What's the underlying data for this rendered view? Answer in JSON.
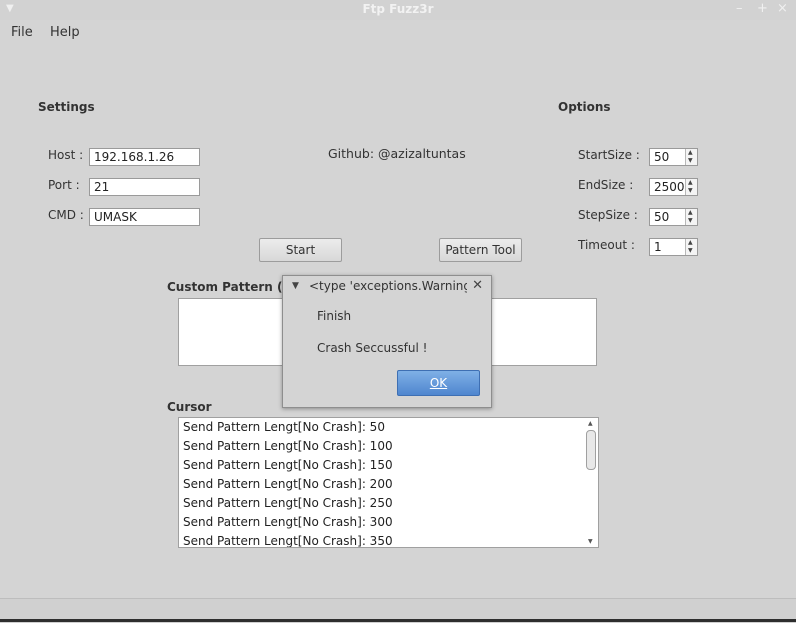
{
  "window": {
    "title": "Ftp Fuzz3r"
  },
  "menubar": {
    "file": "File",
    "help": "Help"
  },
  "settings": {
    "heading": "Settings",
    "host_label": "Host :",
    "host_value": "192.168.1.26",
    "port_label": "Port  :",
    "port_value": "21",
    "cmd_label": "CMD :",
    "cmd_value": "UMASK"
  },
  "github": "Github: @azizaltuntas",
  "options": {
    "heading": "Options",
    "startsize_label": "StartSize :",
    "startsize_value": "50",
    "endsize_label": "EndSize   :",
    "endsize_value": "2500",
    "stepsize_label": "StepSize  :",
    "stepsize_value": "50",
    "timeout_label": "Timeout   :",
    "timeout_value": "1"
  },
  "buttons": {
    "start": "Start",
    "pattern_tool": "Pattern Tool"
  },
  "custom_pattern": {
    "label": "Custom Pattern (Or"
  },
  "cursor": {
    "label": "Cursor",
    "lines": [
      "Send Pattern Lengt[No Crash]: 50",
      "Send Pattern Lengt[No Crash]: 100",
      "Send Pattern Lengt[No Crash]: 150",
      "Send Pattern Lengt[No Crash]: 200",
      "Send Pattern Lengt[No Crash]: 250",
      "Send Pattern Lengt[No Crash]: 300",
      "Send Pattern Lengt[No Crash]: 350"
    ]
  },
  "dialog": {
    "title": "<type 'exceptions.Warning",
    "message1": "Finish",
    "message2": "Crash Seccussful !",
    "ok": "OK"
  }
}
